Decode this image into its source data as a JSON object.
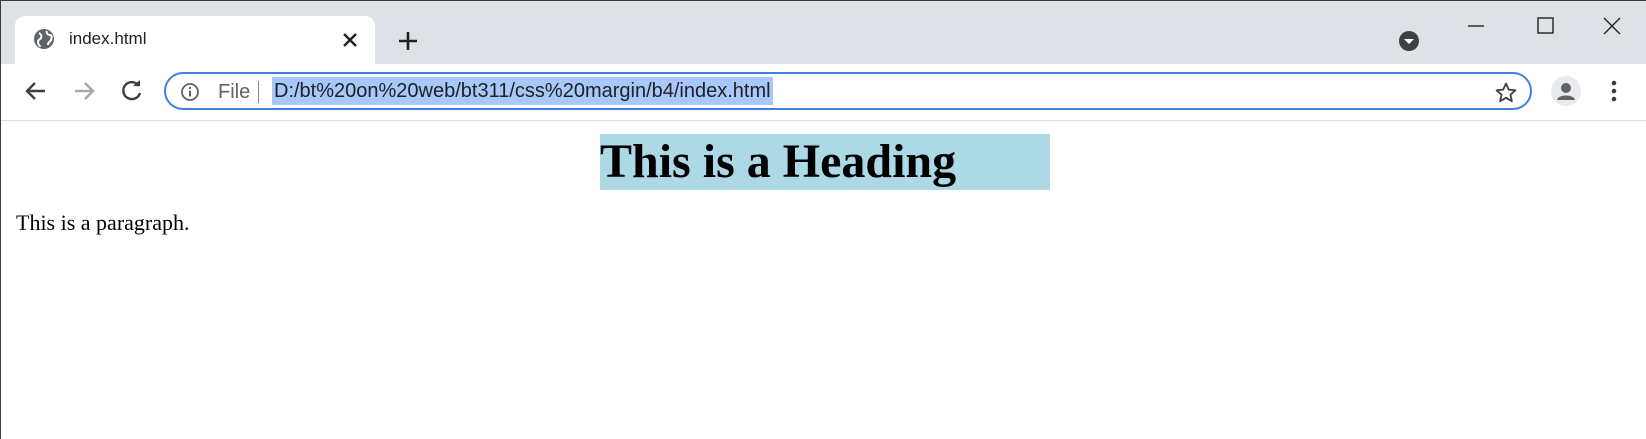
{
  "browser": {
    "tab": {
      "title": "index.html",
      "favicon": "globe-icon"
    },
    "toolbar": {
      "scheme_label": "File",
      "url": "D:/bt%20on%20web/bt311/css%20margin/b4/index.html"
    },
    "colors": {
      "tabstrip": "#dee1e6",
      "omnibox_focus": "#3f80e0",
      "url_selection": "#a8c7fa"
    }
  },
  "page": {
    "heading": "This is a Heading",
    "heading_background": "#add8e6",
    "paragraph": "This is a paragraph."
  }
}
